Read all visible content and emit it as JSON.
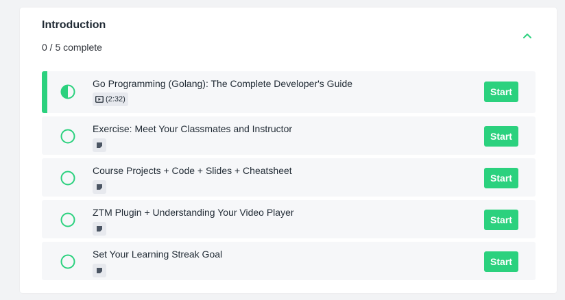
{
  "section": {
    "title": "Introduction",
    "progress": "0 / 5 complete"
  },
  "colors": {
    "accent": "#2bd17e",
    "text": "#1f2933",
    "row_bg": "#f6f7f9"
  },
  "lectures": [
    {
      "title": "Go Programming (Golang): The Complete Developer's Guide",
      "type_icon": "video-icon",
      "duration": "(2:32)",
      "status": "in-progress",
      "action": "Start"
    },
    {
      "title": "Exercise: Meet Your Classmates and Instructor",
      "type_icon": "text-icon",
      "duration": "",
      "status": "not-started",
      "action": "Start"
    },
    {
      "title": "Course Projects + Code + Slides + Cheatsheet",
      "type_icon": "text-icon",
      "duration": "",
      "status": "not-started",
      "action": "Start"
    },
    {
      "title": "ZTM Plugin + Understanding Your Video Player",
      "type_icon": "text-icon",
      "duration": "",
      "status": "not-started",
      "action": "Start"
    },
    {
      "title": "Set Your Learning Streak Goal",
      "type_icon": "text-icon",
      "duration": "",
      "status": "not-started",
      "action": "Start"
    }
  ]
}
